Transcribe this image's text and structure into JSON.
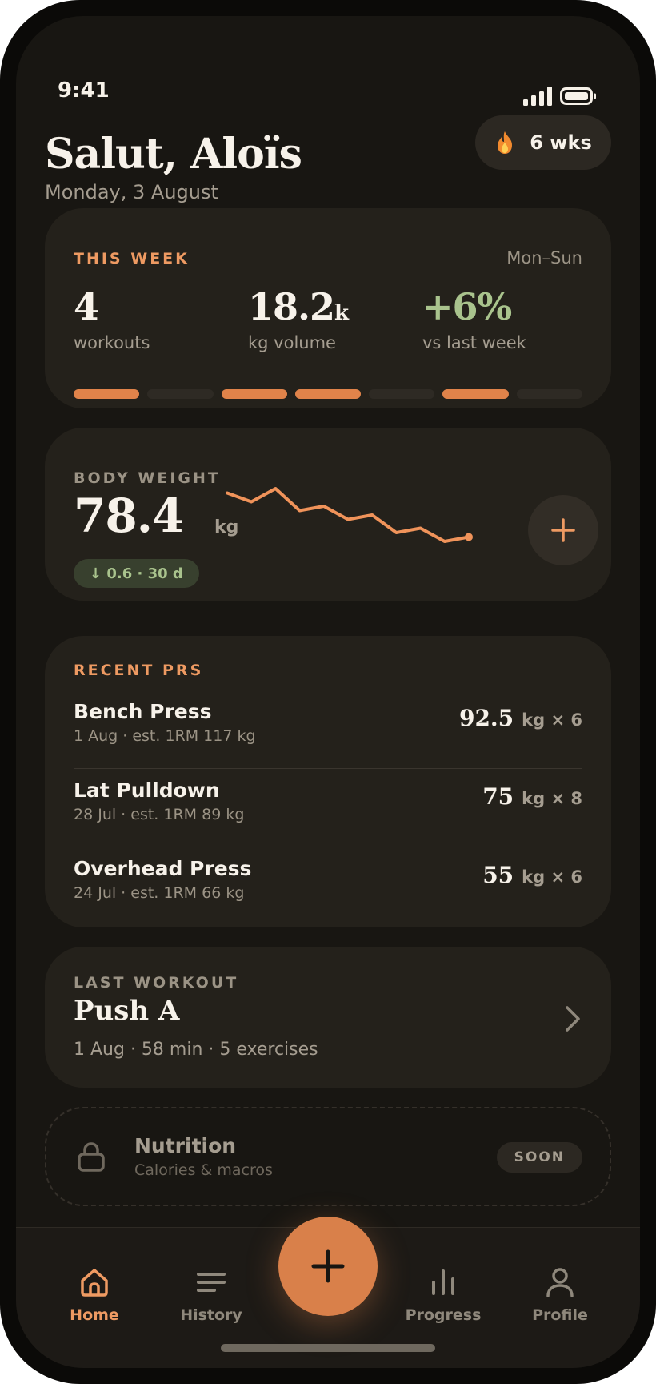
{
  "status_bar": {
    "time": "9:41"
  },
  "header": {
    "greeting": "Salut, Aloïs",
    "date": "Monday, 3 August",
    "streak": "6 wks"
  },
  "this_week": {
    "title": "THIS WEEK",
    "range": "Mon–Sun",
    "stats": [
      {
        "value": "4",
        "suffix": "",
        "label": "workouts"
      },
      {
        "value": "18.2",
        "suffix": "k",
        "label": "kg volume"
      },
      {
        "value": "+6%",
        "suffix": "",
        "label": "vs last week"
      }
    ],
    "days_trained": [
      true,
      false,
      true,
      true,
      false,
      true,
      false
    ]
  },
  "body_weight": {
    "title": "BODY WEIGHT",
    "value": "78.4",
    "unit": "kg",
    "change": "↓ 0.6 · 30 d",
    "trend": [
      79.0,
      78.9,
      79.05,
      78.8,
      78.85,
      78.7,
      78.75,
      78.55,
      78.6,
      78.45,
      78.5
    ]
  },
  "recent_prs": {
    "title": "RECENT PRS",
    "items": [
      {
        "name": "Bench Press",
        "meta": "1 Aug · est. 1RM 117 kg",
        "weight": "92.5",
        "reps": "kg × 6"
      },
      {
        "name": "Lat Pulldown",
        "meta": "28 Jul · est. 1RM 89 kg",
        "weight": "75",
        "reps": "kg × 8"
      },
      {
        "name": "Overhead Press",
        "meta": "24 Jul · est. 1RM 66 kg",
        "weight": "55",
        "reps": "kg × 6"
      }
    ]
  },
  "last_workout": {
    "title": "LAST WORKOUT",
    "name": "Push A",
    "meta": "1 Aug · 58 min · 5 exercises"
  },
  "nutrition": {
    "title": "Nutrition",
    "subtitle": "Calories & macros",
    "badge": "SOON"
  },
  "tabbar": {
    "items": [
      {
        "label": "Home",
        "icon": "home-icon",
        "active": true
      },
      {
        "label": "History",
        "icon": "list-icon",
        "active": false
      },
      {
        "label": "Progress",
        "icon": "bar-chart-icon",
        "active": false
      },
      {
        "label": "Profile",
        "icon": "person-icon",
        "active": false
      }
    ],
    "fab_icon": "plus-icon"
  },
  "colors": {
    "accent": "#e0834a",
    "positive": "#a9c38d",
    "background": "#181612",
    "card": "#24211b"
  }
}
